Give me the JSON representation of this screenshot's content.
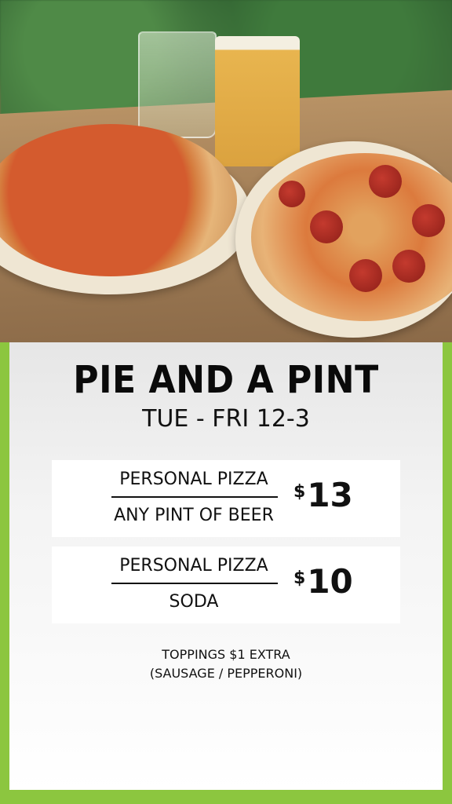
{
  "promo": {
    "title": "PIE AND A PINT",
    "schedule": "TUE - FRI 12-3",
    "offers": [
      {
        "item_top": "PERSONAL PIZZA",
        "item_bottom": "ANY PINT OF BEER",
        "currency": "$",
        "price": "13"
      },
      {
        "item_top": "PERSONAL PIZZA",
        "item_bottom": "SODA",
        "currency": "$",
        "price": "10"
      }
    ],
    "note_line1": "TOPPINGS $1 EXTRA",
    "note_line2": "(SAUSAGE / PEPPERONI)"
  },
  "colors": {
    "border_green": "#8cc63f",
    "text": "#111111",
    "panel": "#ffffff"
  },
  "photo": {
    "subject": "cheese-pizza-pepperoni-pizza-and-beer-photo"
  }
}
